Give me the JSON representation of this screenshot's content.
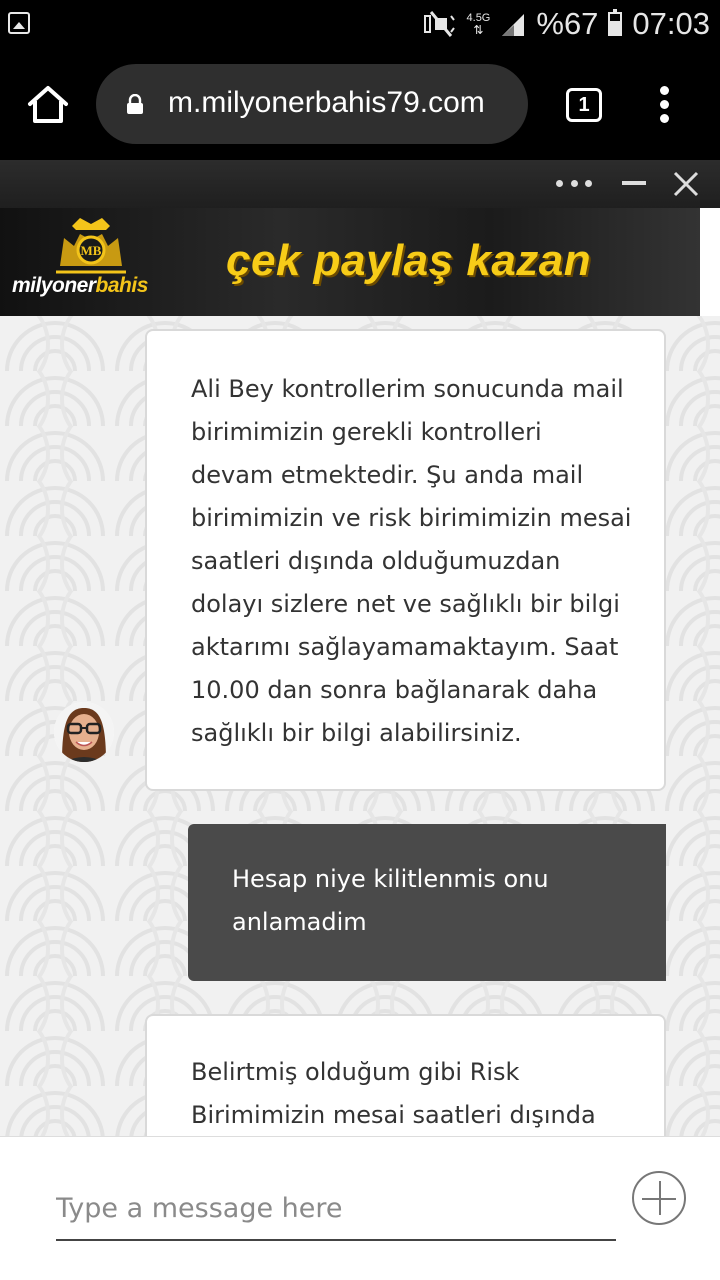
{
  "status_bar": {
    "network_label": "4.5G",
    "battery_text": "%67",
    "battery_level": 0.67,
    "time": "07:03",
    "icons": [
      "gallery-icon",
      "mute-icon",
      "data-arrows-icon",
      "signal-icon",
      "battery-icon"
    ]
  },
  "browser": {
    "url": "m.milyonerbahis79.com",
    "tab_count": "1",
    "icons": [
      "home-icon",
      "lock-icon",
      "tabs-icon",
      "overflow-menu-icon"
    ]
  },
  "chat_header": {
    "icons": [
      "more-dots-icon",
      "minimize-icon",
      "close-icon"
    ]
  },
  "banner": {
    "logo_text_1": "milyoner",
    "logo_text_2": "bahis",
    "slogan": "çek paylaş kazan",
    "colors": {
      "gold": "#f7cc18"
    }
  },
  "messages": [
    {
      "sender": "agent",
      "lines": [
        "Ali Bey kontrollerim sonucunda mail",
        "birimimizin gerekli kontrolleri",
        "devam etmektedir. Şu anda mail",
        "birimimizin ve risk birimimizin mesai",
        "saatleri dışında olduğumuzdan",
        "dolayı sizlere net ve sağlıklı bir bilgi",
        "aktarımı sağlayamamaktayım. Saat",
        "10.00 dan sonra bağlanarak daha",
        "sağlıklı bir bilgi alabilirsiniz."
      ]
    },
    {
      "sender": "user",
      "lines": [
        "Hesap niye kilitlenmis onu",
        "anlamadim"
      ]
    },
    {
      "sender": "agent",
      "lines": [
        "Belirtmiş olduğum gibi Risk",
        "Birimimizin mesai saatleri dışında"
      ]
    }
  ],
  "composer": {
    "placeholder": "Type a message here",
    "value": "",
    "icons": [
      "add-icon"
    ]
  },
  "colors": {
    "user_bubble": "#4a4a4a",
    "agent_bubble": "#ffffff"
  }
}
